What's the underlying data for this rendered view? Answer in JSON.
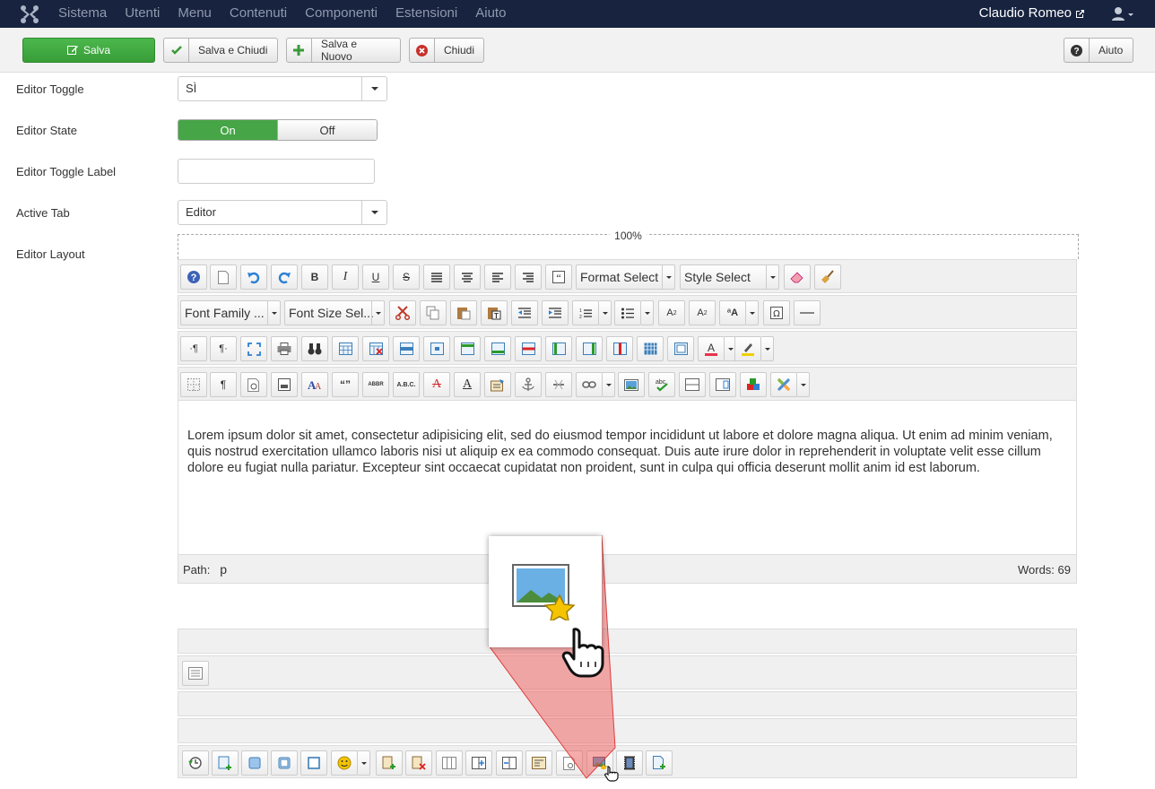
{
  "nav": {
    "items": [
      "Sistema",
      "Utenti",
      "Menu",
      "Contenuti",
      "Componenti",
      "Estensioni",
      "Aiuto"
    ],
    "user": "Claudio Romeo"
  },
  "toolbar": {
    "save": "Salva",
    "save_close": "Salva e Chiudi",
    "save_new": "Salva e Nuovo",
    "close": "Chiudi",
    "help": "Aiuto"
  },
  "form": {
    "editor_toggle": {
      "label": "Editor Toggle",
      "value": "SÌ"
    },
    "editor_state": {
      "label": "Editor State",
      "on": "On",
      "off": "Off",
      "selected": "On"
    },
    "editor_toggle_label": {
      "label": "Editor Toggle Label",
      "value": ""
    },
    "active_tab": {
      "label": "Active Tab",
      "value": "Editor"
    },
    "editor_layout": {
      "label": "Editor Layout",
      "width": "100%"
    }
  },
  "editor": {
    "format_select": "Format Select",
    "style_select": "Style Select",
    "font_family": "Font Family ...",
    "font_size": "Font Size Sel...",
    "content": "Lorem ipsum dolor sit amet, consectetur adipisicing elit, sed do eiusmod tempor incididunt ut labore et dolore magna aliqua. Ut enim ad minim veniam, quis nostrud exercitation ullamco laboris nisi ut aliquip ex ea commodo consequat. Duis aute irure dolor in reprehenderit in voluptate velit esse cillum dolore eu fugiat nulla pariatur. Excepteur sint occaecat cupidatat non proident, sunt in culpa qui officia deserunt mollit anim id est laborum.",
    "path_label": "Path:",
    "path_value": "p",
    "words": "Words: 69"
  },
  "colors": {
    "topbar": "#17233f",
    "save": "#46a546",
    "accent_red": "#e03c3c"
  }
}
